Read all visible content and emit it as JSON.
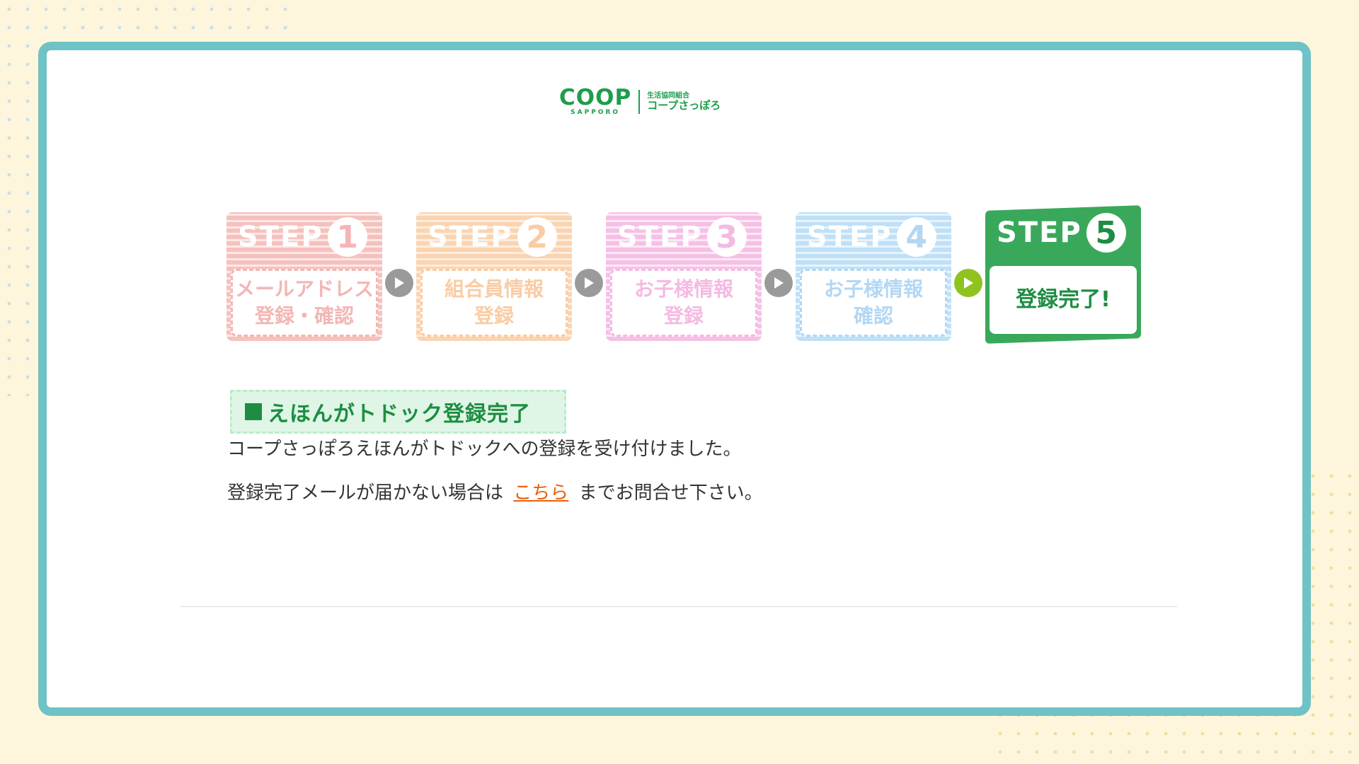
{
  "logo": {
    "brand": "COOP",
    "brand_sub": "SAPPORO",
    "org_small": "生活協同組合",
    "org_name": "コープさっぽろ"
  },
  "steps": [
    {
      "step_word": "STEP",
      "number": "1",
      "line1": "メールアドレス",
      "line2": "登録・確認",
      "state": "done"
    },
    {
      "step_word": "STEP",
      "number": "2",
      "line1": "組合員情報",
      "line2": "登録",
      "state": "done"
    },
    {
      "step_word": "STEP",
      "number": "3",
      "line1": "お子様情報",
      "line2": "登録",
      "state": "done"
    },
    {
      "step_word": "STEP",
      "number": "4",
      "line1": "お子様情報",
      "line2": "確認",
      "state": "done"
    },
    {
      "step_word": "STEP",
      "number": "5",
      "line1": "登録完了!",
      "state": "current"
    }
  ],
  "colors": {
    "frame": "#6fc2c5",
    "brand_green": "#1e8d43",
    "step1": "#ea7b78",
    "step2": "#f5a457",
    "step3": "#ec82cc",
    "step4": "#75b7ec",
    "step5": "#3aa85a",
    "link": "#e8600a"
  },
  "content": {
    "heading": "えほんがトドック登録完了",
    "message1": "コープさっぽろえほんがトドックへの登録を受け付けました。",
    "message2_before": "登録完了メールが届かない場合は",
    "message2_link": "こちら",
    "message2_after": "までお問合せ下さい。"
  }
}
